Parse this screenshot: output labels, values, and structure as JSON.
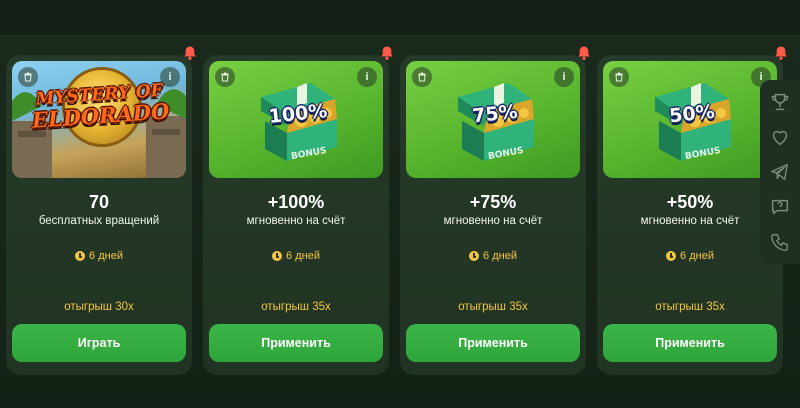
{
  "cards": [
    {
      "type": "game",
      "title_line1": "MYSTERY OF",
      "title_line2": "ELDORADO",
      "value": "70",
      "description": "бесплатных вращений",
      "days": "6 дней",
      "wager": "отыгрыш 30х",
      "action_label": "Играть"
    },
    {
      "type": "bonus",
      "percent": "100%",
      "bonus_word": "BONUS",
      "value": "+100%",
      "description": "мгновенно на счёт",
      "days": "6 дней",
      "wager": "отыгрыш 35х",
      "action_label": "Применить"
    },
    {
      "type": "bonus",
      "percent": "75%",
      "bonus_word": "BONUS",
      "value": "+75%",
      "description": "мгновенно на счёт",
      "days": "6 дней",
      "wager": "отыгрыш 35х",
      "action_label": "Применить"
    },
    {
      "type": "bonus",
      "percent": "50%",
      "bonus_word": "BONUS",
      "value": "+50%",
      "description": "мгновенно на счёт",
      "days": "6 дней",
      "wager": "отыгрыш 35х",
      "action_label": "Применить"
    }
  ],
  "info_glyph": "i",
  "sidebar_icons": [
    "trophy-icon",
    "heart-icon",
    "telegram-icon",
    "support-chat-icon",
    "phone-icon"
  ],
  "colors": {
    "accent_green": "#34ad41",
    "highlight_yellow": "#f5c542",
    "notification_red": "#ff5a4a",
    "card_bg": "#243826"
  }
}
